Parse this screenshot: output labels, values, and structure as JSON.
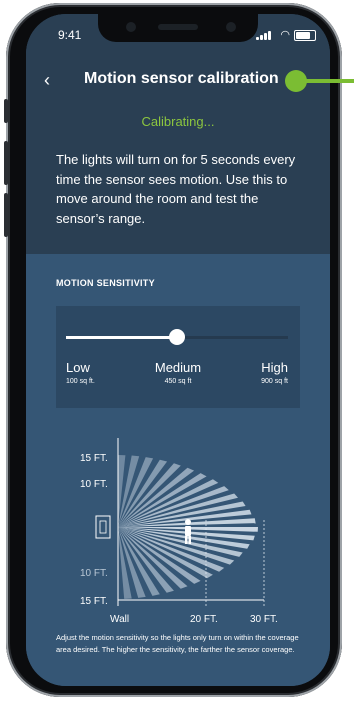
{
  "status": {
    "time": "9:41"
  },
  "header": {
    "title": "Motion sensor calibration",
    "back_icon": "chevron-left-icon"
  },
  "calibrating_text": "Calibrating...",
  "instructions": "The lights will turn on for 5 seconds every time the sensor sees motion. Use this to move around the room and test the sensor’s range.",
  "sensitivity": {
    "label": "MOTION SENSITIVITY",
    "value_fraction": 0.5,
    "ticks": [
      {
        "label": "Low",
        "sub": "100 sq ft."
      },
      {
        "label": "Medium",
        "sub": "450 sq ft"
      },
      {
        "label": "High",
        "sub": "900 sq ft"
      }
    ]
  },
  "coverage": {
    "y_labels": [
      "15 FT.",
      "10 FT.",
      "10 FT.",
      "15 FT."
    ],
    "x_labels": [
      "Wall",
      "20 FT.",
      "30 FT."
    ]
  },
  "caption": "Adjust the motion sensitivity so the lights only turn on within the coverage area desired. The higher the sensitivity, the farther the sensor coverage.",
  "colors": {
    "accent": "#8cc63f",
    "marker": "#7bbd33"
  }
}
